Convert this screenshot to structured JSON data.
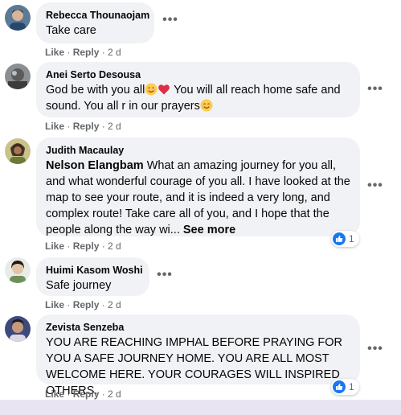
{
  "action_labels": {
    "like": "Like",
    "reply": "Reply"
  },
  "more_label": "•••",
  "comments": [
    {
      "author": "Rebecca Thounaojam",
      "text": "Take care",
      "time": "2 d"
    },
    {
      "author": "Anei Serto Desousa",
      "text_part1": "God be with you all",
      "text_part2": " You will all reach home safe and sound. You all r in our prayers",
      "time": "2 d"
    },
    {
      "author": "Judith Macaulay",
      "mention": "Nelson Elangbam",
      "text": " What an amazing journey for you all, and what wonderful courage of you all. I have looked at the map to see your route, and it is indeed a very long, and complex route! Take care all of you, and I hope that the people along the way wi...",
      "see_more": "See more",
      "time": "2 d",
      "reaction_count": "1"
    },
    {
      "author": "Huimi Kasom Woshi",
      "text": "Safe journey",
      "time": "2 d"
    },
    {
      "author": "Zevista Senzeba",
      "text": "YOU ARE REACHING IMPHAL BEFORE PRAYING FOR YOU A SAFE JOURNEY HOME. YOU ARE ALL MOST WELCOME HERE. YOUR COURAGES WILL INSPIRED OTHERS.",
      "time": "2 d",
      "reaction_count": "1"
    }
  ]
}
